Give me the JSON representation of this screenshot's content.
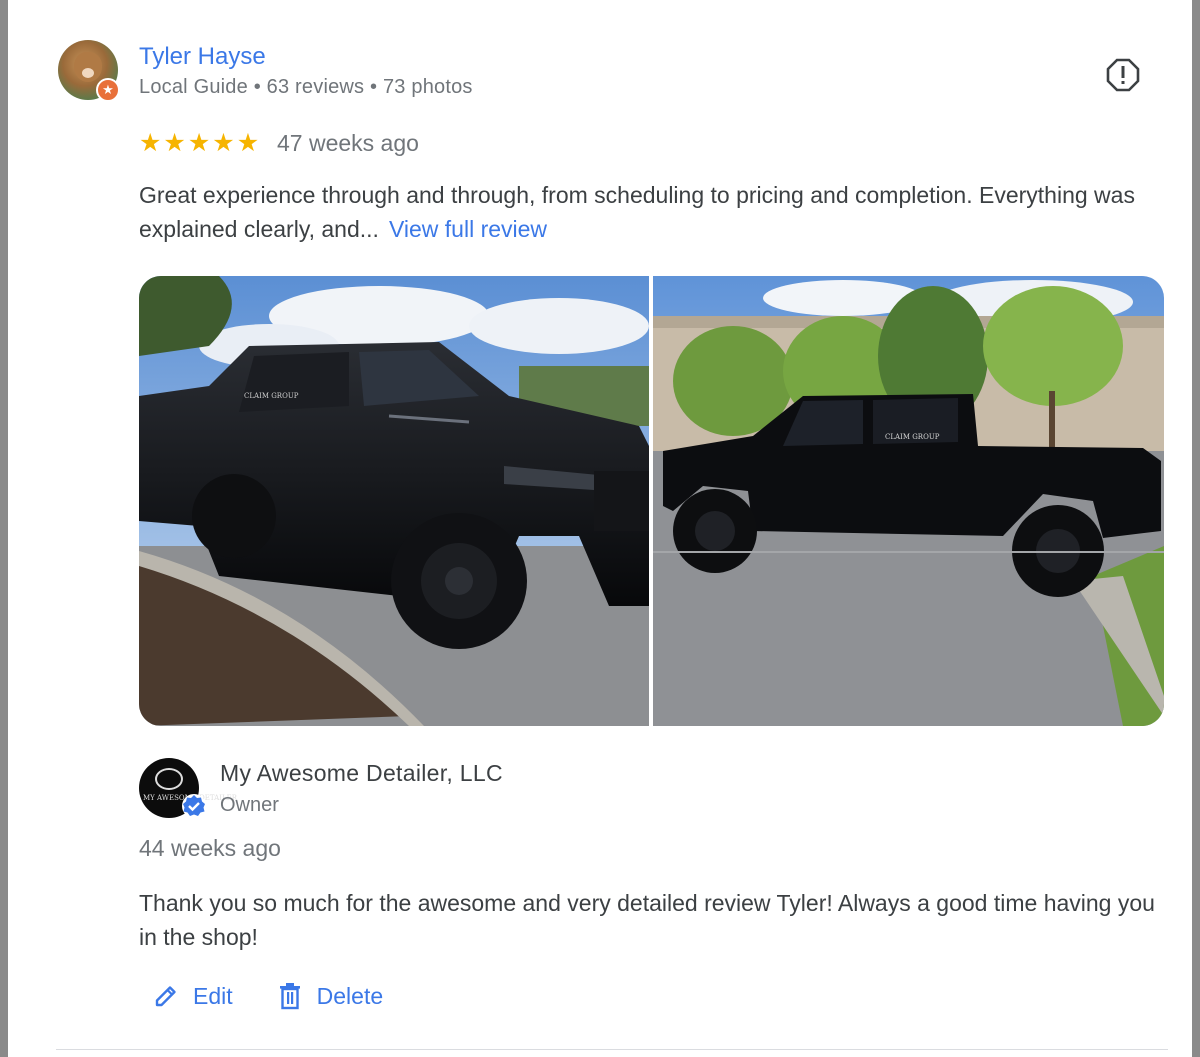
{
  "reviewer": {
    "name": "Tyler Hayse",
    "meta": "Local Guide • 63 reviews • 73 photos",
    "badge_icon": "local-guide-star"
  },
  "review": {
    "rating": 5,
    "rating_max": 5,
    "time": "47 weeks ago",
    "text": "Great experience through and through, from scheduling to pricing and completion. Everything was explained clearly, and...",
    "more_label": "View full review",
    "photos": [
      {
        "subject": "black-pickup-truck-front-three-quarter",
        "label": "CLAIM GROUP"
      },
      {
        "subject": "black-pickup-truck-side-profile",
        "label": "CLAIM GROUP"
      }
    ]
  },
  "owner_reply": {
    "name": "My Awesome Detailer, LLC",
    "role": "Owner",
    "logo_text": "MY AWESOME DETAILER",
    "time": "44 weeks ago",
    "text": "Thank you so much for the awesome and very detailed review Tyler! Always a good time having you in the shop!"
  },
  "actions": {
    "edit_label": "Edit",
    "delete_label": "Delete"
  },
  "colors": {
    "link": "#3b78e7",
    "star": "#f6b400",
    "text": "#3c4043",
    "muted": "#70757a",
    "badge": "#e8703a"
  }
}
